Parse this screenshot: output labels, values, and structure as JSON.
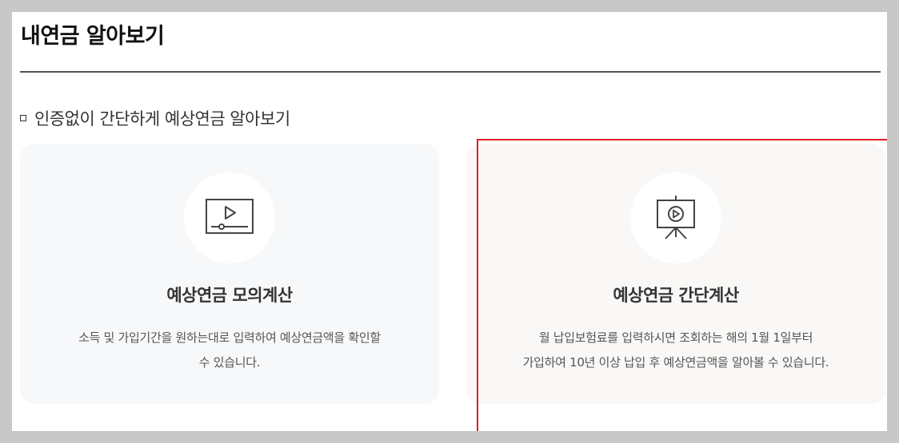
{
  "page": {
    "title": "내연금 알아보기",
    "section_heading": "인증없이 간단하게 예상연금 알아보기"
  },
  "cards": [
    {
      "icon": "video-player-icon",
      "title": "예상연금 모의계산",
      "desc_line1": "소득 및 가입기간을 원하는대로 입력하여 예상연금액을 확인할",
      "desc_line2": "수 있습니다."
    },
    {
      "icon": "presentation-easel-icon",
      "title": "예상연금 간단계산",
      "desc_line1": "월 납입보험료를 입력하시면 조회하는 해의 1월 1일부터",
      "desc_line2": "가입하여 10년 이상 납입 후 예상연금액을 알아볼 수 있습니다."
    }
  ],
  "colors": {
    "highlight": "#e11b22",
    "card_left_bg": "#f7f8fa",
    "card_right_bg": "#f9f8f6",
    "icon_stroke": "#444444"
  }
}
